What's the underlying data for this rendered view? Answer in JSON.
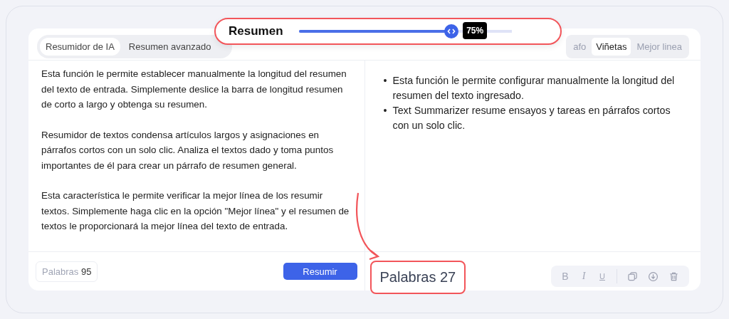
{
  "mode_tabs": [
    {
      "label": "Resumidor de IA",
      "selected": true
    },
    {
      "label": "Resumen avanzado",
      "selected": false
    }
  ],
  "format_tabs": [
    {
      "label": "afo",
      "selected": false
    },
    {
      "label": "Viñetas",
      "selected": true
    },
    {
      "label": "Mejor linea",
      "selected": false
    }
  ],
  "length_callout": {
    "title": "Resumen",
    "level": 0.75,
    "reading": "75%"
  },
  "input_paragraphs": [
    "Esta función le permite establecer manualmente la longitud del resumen del texto de entrada. Simplemente deslice la barra de longitud resumen de corto a largo y obtenga su resumen.",
    "Resumidor de textos condensa artículos largos y asignaciones en párrafos cortos con un solo clic. Analiza el textos dado y toma puntos importantes de él para crear un párrafo de resumen general.",
    "Esta característica le permite verificar la mejor línea de los resumir textos. Simplemente haga clic en la opción \"Mejor línea\" y el resumen de textos le proporcionará la mejor línea del texto de entrada."
  ],
  "output_bullets": [
    {
      "marker": "•",
      "text": "Esta función le permite configurar manualmente la longitud del resumen del texto ingresado."
    },
    {
      "marker": "•",
      "text": "Text Summarizer resume ensayos y tareas en párrafos cortos con un solo clic."
    }
  ],
  "input_footer": {
    "word_label": "Palabras",
    "word_count": "95",
    "button": "Resumir"
  },
  "output_footer": {
    "word_count_text": "Palabras 27",
    "tools": [
      {
        "kind": "bold",
        "label": "B"
      },
      {
        "kind": "italic",
        "label": "I"
      },
      {
        "kind": "underline",
        "label": "U"
      },
      {
        "kind": "copy"
      },
      {
        "kind": "download"
      },
      {
        "kind": "delete"
      }
    ]
  }
}
